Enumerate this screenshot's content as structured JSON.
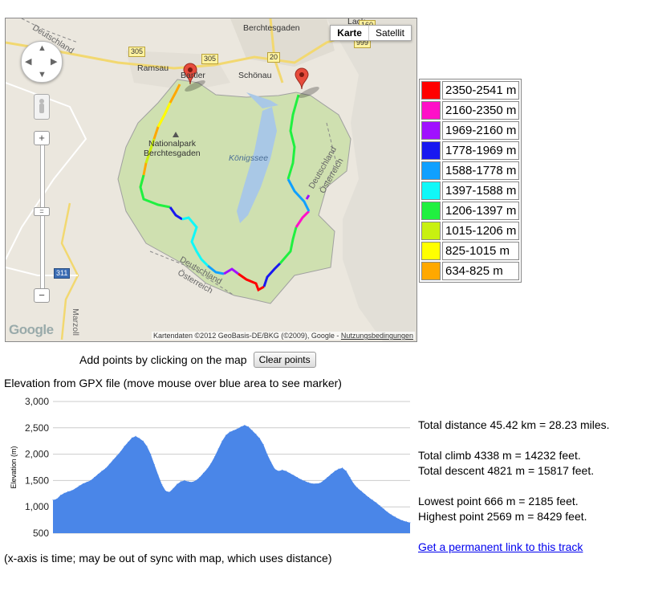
{
  "map": {
    "type_buttons": [
      "Karte",
      "Satellit"
    ],
    "selected_type": "Karte",
    "labels": {
      "lack": "Lack",
      "berchtesgaden": "Berchtesgaden",
      "ramsau": "Ramsau",
      "bartler": "Bartler",
      "schonau": "Schönau",
      "nationalpark": "Nationalpark",
      "nationalpark2": "Berchtesgaden",
      "konigssee": "Königssee",
      "deutschland_nw": "Deutschland",
      "deutschland_e": "Deutschland",
      "osterreich_e": "Österreich",
      "deutschland_s": "Deutschland",
      "osterreich_s": "Österreich",
      "marzoll": "Marzoll"
    },
    "road_signs": {
      "r305a": "305",
      "r305b": "305",
      "r20": "20",
      "r999": "999",
      "r311": "311",
      "r160": "160"
    },
    "google_logo": "Google",
    "copyright": "Kartendaten ©2012 GeoBasis-DE/BKG (©2009), Google -",
    "terms": "Nutzungsbedingungen"
  },
  "legend": [
    {
      "color": "#ff0000",
      "label": "2350-2541 m"
    },
    {
      "color": "#ff10c8",
      "label": "2160-2350 m"
    },
    {
      "color": "#a010ff",
      "label": "1969-2160 m"
    },
    {
      "color": "#1818f0",
      "label": "1778-1969 m"
    },
    {
      "color": "#10a0ff",
      "label": "1588-1778 m"
    },
    {
      "color": "#10f8f8",
      "label": "1397-1588 m"
    },
    {
      "color": "#20f040",
      "label": "1206-1397 m"
    },
    {
      "color": "#c8f010",
      "label": "1015-1206 m"
    },
    {
      "color": "#ffff00",
      "label": "825-1015 m"
    },
    {
      "color": "#ffa800",
      "label": "634-825 m"
    }
  ],
  "controls": {
    "add_points_text": "Add points by clicking on the map",
    "clear_button": "Clear points"
  },
  "chart_title": "Elevation from GPX file (move mouse over blue area to see marker)",
  "chart_data": {
    "type": "area",
    "ylabel": "Elevation (m)",
    "ylim": [
      500,
      3000
    ],
    "yticks": [
      "3,000",
      "2,500",
      "2,000",
      "1,500",
      "1,000",
      "500"
    ],
    "ytick_values": [
      3000,
      2500,
      2000,
      1500,
      1000,
      500
    ],
    "fill_color": "#4a86e8",
    "values": [
      1130,
      1150,
      1220,
      1260,
      1290,
      1310,
      1350,
      1400,
      1440,
      1470,
      1500,
      1560,
      1620,
      1680,
      1730,
      1810,
      1890,
      1970,
      2050,
      2150,
      2230,
      2310,
      2340,
      2300,
      2250,
      2150,
      2000,
      1800,
      1600,
      1420,
      1300,
      1280,
      1350,
      1430,
      1480,
      1500,
      1480,
      1470,
      1500,
      1560,
      1640,
      1720,
      1820,
      1950,
      2100,
      2250,
      2360,
      2420,
      2450,
      2480,
      2520,
      2550,
      2520,
      2450,
      2380,
      2300,
      2180,
      2000,
      1850,
      1720,
      1680,
      1700,
      1680,
      1640,
      1600,
      1560,
      1520,
      1490,
      1460,
      1440,
      1440,
      1450,
      1500,
      1560,
      1620,
      1680,
      1720,
      1740,
      1680,
      1560,
      1440,
      1360,
      1300,
      1240,
      1180,
      1130,
      1080,
      1020,
      960,
      900,
      850,
      810,
      770,
      740,
      720,
      700
    ]
  },
  "stats": {
    "distance": "Total distance 45.42 km = 28.23 miles.",
    "climb": "Total climb 4338 m = 14232 feet.",
    "descent": "Total descent 4821 m = 15817 feet.",
    "lowest": "Lowest point 666 m = 2185 feet.",
    "highest": "Highest point 2569 m = 8429 feet.",
    "link": "Get a permanent link to this track"
  },
  "x_note": "(x-axis is time; may be out of sync with map, which uses distance)"
}
